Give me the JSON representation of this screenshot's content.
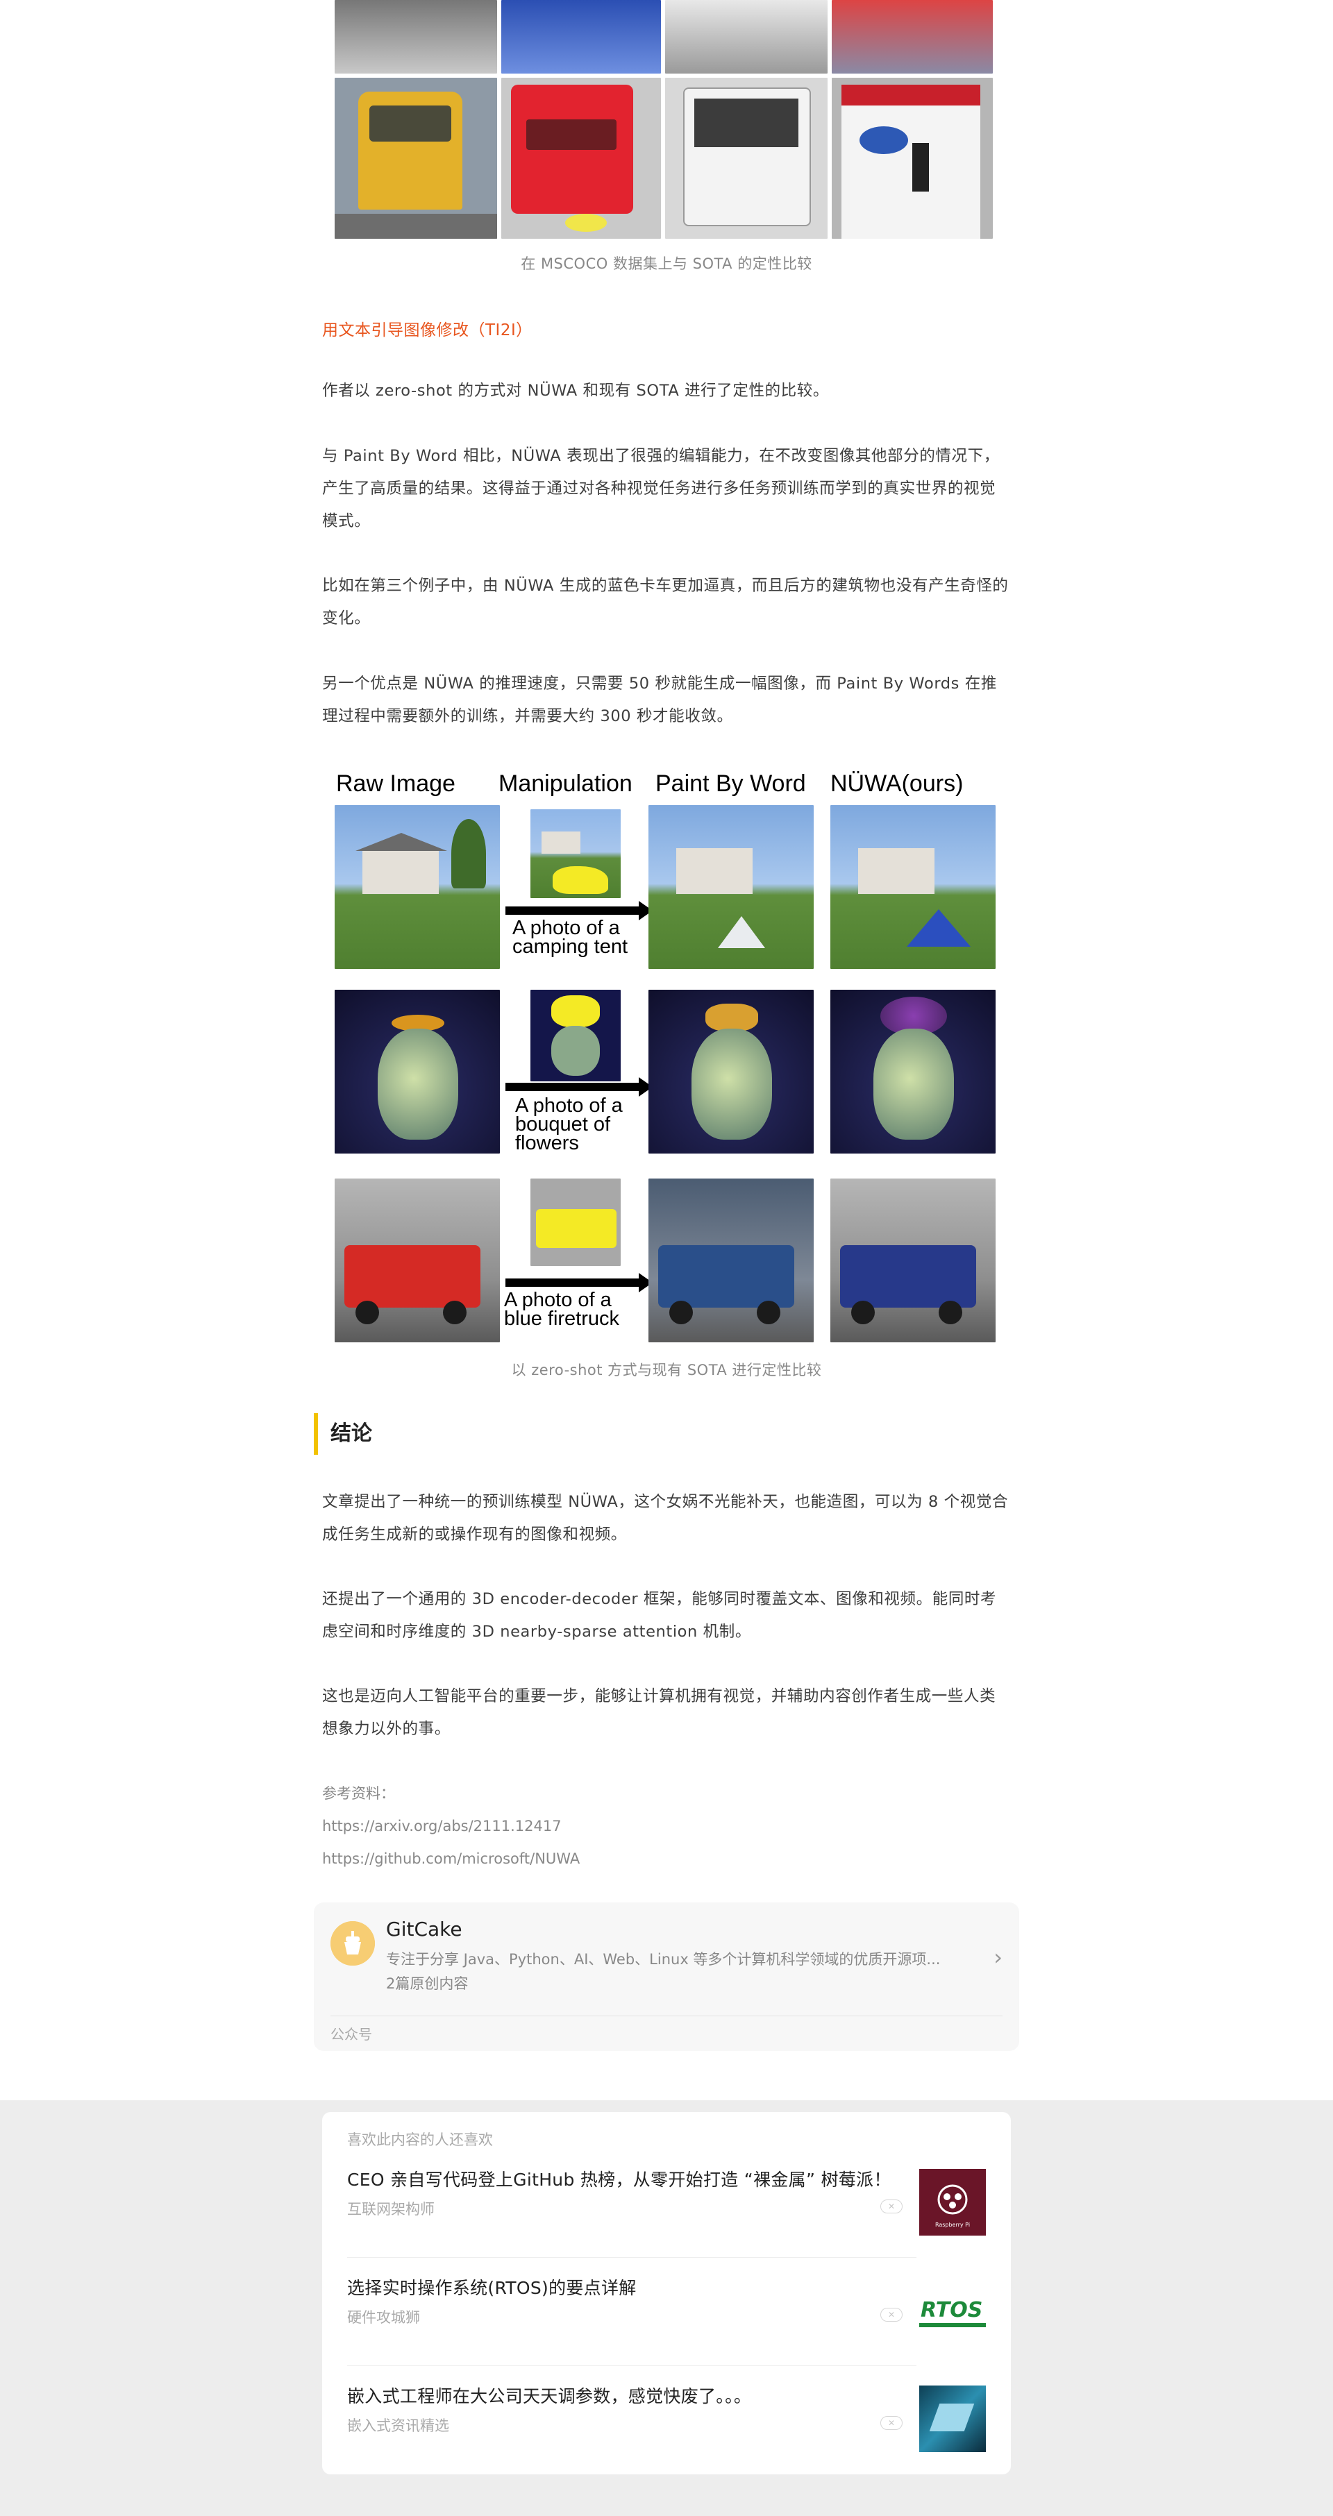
{
  "mscoco_caption": "在 MSCOCO 数据集上与 SOTA 的定性比较",
  "section_ti2i_heading": "用文本引导图像修改（TI2I）",
  "paragraphs": [
    "作者以 zero-shot 的方式对 NÜWA 和现有 SOTA 进行了定性的比较。",
    "与 Paint By Word 相比，NÜWA 表现出了很强的编辑能力，在不改变图像其他部分的情况下，产生了高质量的结果。这得益于通过对各种视觉任务进行多任务预训练而学到的真实世界的视觉模式。",
    "比如在第三个例子中，由 NÜWA 生成的蓝色卡车更加逼真，而且后方的建筑物也没有产生奇怪的变化。",
    "另一个优点是 NÜWA 的推理速度，只需要 50 秒就能生成一幅图像，而 Paint By Words 在推理过程中需要额外的训练，并需要大约 300 秒才能收敛。"
  ],
  "figure": {
    "headers": [
      "Raw Image",
      "Manipulation",
      "Paint By Word",
      "NÜWA(ours)"
    ],
    "prompts": [
      [
        "A photo of a",
        "camping tent"
      ],
      [
        "A photo of a",
        "bouquet of",
        "flowers"
      ],
      [
        "A photo of a",
        "blue firetruck"
      ]
    ],
    "caption": "以 zero-shot 方式与现有 SOTA 进行定性比较"
  },
  "conclusion": {
    "title": "结论",
    "paragraphs": [
      "文章提出了一种统一的预训练模型 NÜWA，这个女娲不光能补天，也能造图，可以为 8 个视觉合成任务生成新的或操作现有的图像和视频。",
      "还提出了一个通用的 3D encoder-decoder 框架，能够同时覆盖文本、图像和视频。能同时考虑空间和时序维度的 3D nearby-sparse attention 机制。",
      "这也是迈向人工智能平台的重要一步，能够让计算机拥有视觉，并辅助内容创作者生成一些人类想象力以外的事。"
    ]
  },
  "references": {
    "label": "参考资料：",
    "links": [
      "https://arxiv.org/abs/2111.12417",
      "https://github.com/microsoft/NUWA"
    ]
  },
  "account": {
    "name": "GitCake",
    "description": "专注于分享 Java、Python、AI、Web、Linux 等多个计算机科学领域的优质开源项...",
    "count": "2篇原创内容",
    "type": "公众号"
  },
  "recommendations": {
    "title": "喜欢此内容的人还喜欢",
    "items": [
      {
        "title": "CEO 亲自写代码登上GitHub 热榜，从零开始打造 “裸金属” 树莓派！",
        "source": "互联网架构师",
        "thumb_text": "Raspberry Pi"
      },
      {
        "title": "选择实时操作系统(RTOS)的要点详解",
        "source": "硬件攻城狮",
        "thumb_text": "RTOS"
      },
      {
        "title": "嵌入式工程师在大公司天天调参数，感觉快废了。。。",
        "source": "嵌入式资讯精选",
        "thumb_text": ""
      }
    ]
  },
  "colors": {
    "accent_orange": "#e8561f",
    "section_bar": "#f2c200",
    "page_bg": "#ededed"
  }
}
